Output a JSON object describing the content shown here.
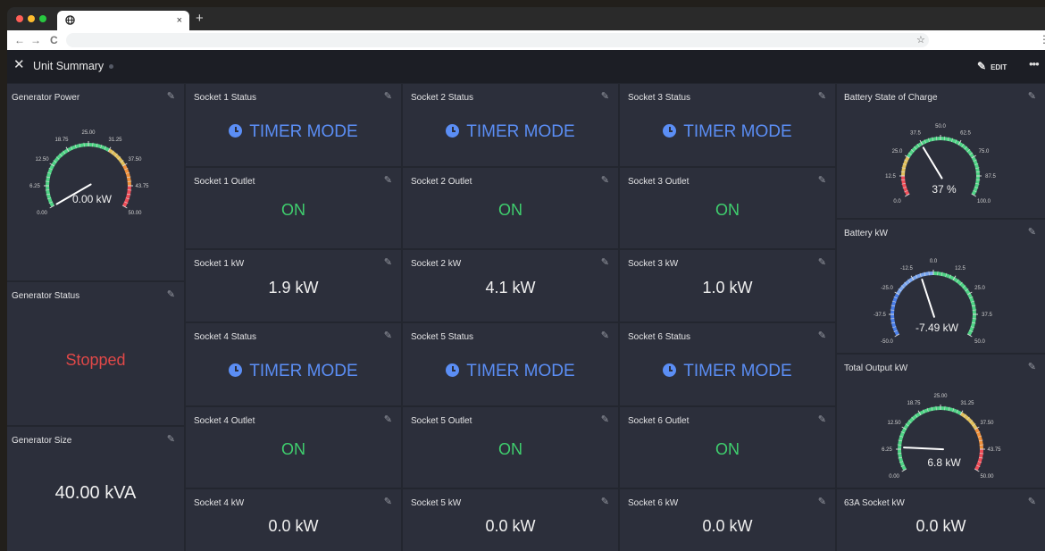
{
  "browser": {
    "tab_icon": "globe-icon",
    "tab_close": "×",
    "new_tab": "+",
    "back": "←",
    "forward": "→",
    "reload": "C",
    "bookmark": "☆",
    "menu": "⋮"
  },
  "appbar": {
    "close": "✕",
    "title": "Unit Summary",
    "edit_label": "EDIT",
    "more": "•••"
  },
  "colors": {
    "background": "#2c2f3b",
    "timer_blue": "#5b8ef5",
    "on_green": "#3fcf6e",
    "stopped_red": "#e04848"
  },
  "cards": {
    "generator_power": {
      "title": "Generator Power",
      "value": "0.00 kW",
      "reading": 0,
      "range": [
        0,
        50
      ],
      "ticks": [
        "0.00",
        "6.25",
        "12.50",
        "18.75",
        "25.00",
        "31.25",
        "37.50",
        "43.75",
        "50.00"
      ]
    },
    "generator_status": {
      "title": "Generator Status",
      "value": "Stopped"
    },
    "generator_size": {
      "title": "Generator Size",
      "value": "40.00 kVA"
    },
    "s1_status": {
      "title": "Socket 1 Status",
      "value": "TIMER MODE"
    },
    "s2_status": {
      "title": "Socket 2 Status",
      "value": "TIMER MODE"
    },
    "s3_status": {
      "title": "Socket 3 Status",
      "value": "TIMER MODE"
    },
    "s1_outlet": {
      "title": "Socket 1 Outlet",
      "value": "ON"
    },
    "s2_outlet": {
      "title": "Socket 2 Outlet",
      "value": "ON"
    },
    "s3_outlet": {
      "title": "Socket 3 Outlet",
      "value": "ON"
    },
    "s1_kw": {
      "title": "Socket 1 kW",
      "value": "1.9 kW"
    },
    "s2_kw": {
      "title": "Socket 2 kW",
      "value": "4.1 kW"
    },
    "s3_kw": {
      "title": "Socket 3 kW",
      "value": "1.0 kW"
    },
    "s4_status": {
      "title": "Socket 4 Status",
      "value": "TIMER MODE"
    },
    "s5_status": {
      "title": "Socket 5 Status",
      "value": "TIMER MODE"
    },
    "s6_status": {
      "title": "Socket 6 Status",
      "value": "TIMER MODE"
    },
    "s4_outlet": {
      "title": "Socket 4 Outlet",
      "value": "ON"
    },
    "s5_outlet": {
      "title": "Socket 5 Outlet",
      "value": "ON"
    },
    "s6_outlet": {
      "title": "Socket 6 Outlet",
      "value": "ON"
    },
    "s4_kw": {
      "title": "Socket 4 kW",
      "value": "0.0 kW"
    },
    "s5_kw": {
      "title": "Socket 5 kW",
      "value": "0.0 kW"
    },
    "s6_kw": {
      "title": "Socket 6 kW",
      "value": "0.0 kW"
    },
    "battery_soc": {
      "title": "Battery State of Charge",
      "value": "37 %",
      "reading": 37,
      "range": [
        0,
        100
      ],
      "ticks": [
        "0.0",
        "12.5",
        "25.0",
        "37.5",
        "50.0",
        "62.5",
        "75.0",
        "87.5",
        "100.0"
      ]
    },
    "battery_kw": {
      "title": "Battery kW",
      "value": "-7.49 kW",
      "reading": -7.49,
      "range": [
        -50,
        50
      ],
      "ticks": [
        "-50.0",
        "-37.5",
        "-25.0",
        "-12.5",
        "0.0",
        "12.5",
        "25.0",
        "37.5",
        "50.0"
      ]
    },
    "total_output": {
      "title": "Total Output kW",
      "value": "6.8 kW",
      "reading": 6.8,
      "range": [
        0,
        50
      ],
      "ticks": [
        "0.00",
        "6.25",
        "12.50",
        "18.75",
        "25.00",
        "31.25",
        "37.50",
        "43.75",
        "50.00"
      ]
    },
    "socket63a_kw": {
      "title": "63A Socket kW",
      "value": "0.0 kW"
    }
  }
}
